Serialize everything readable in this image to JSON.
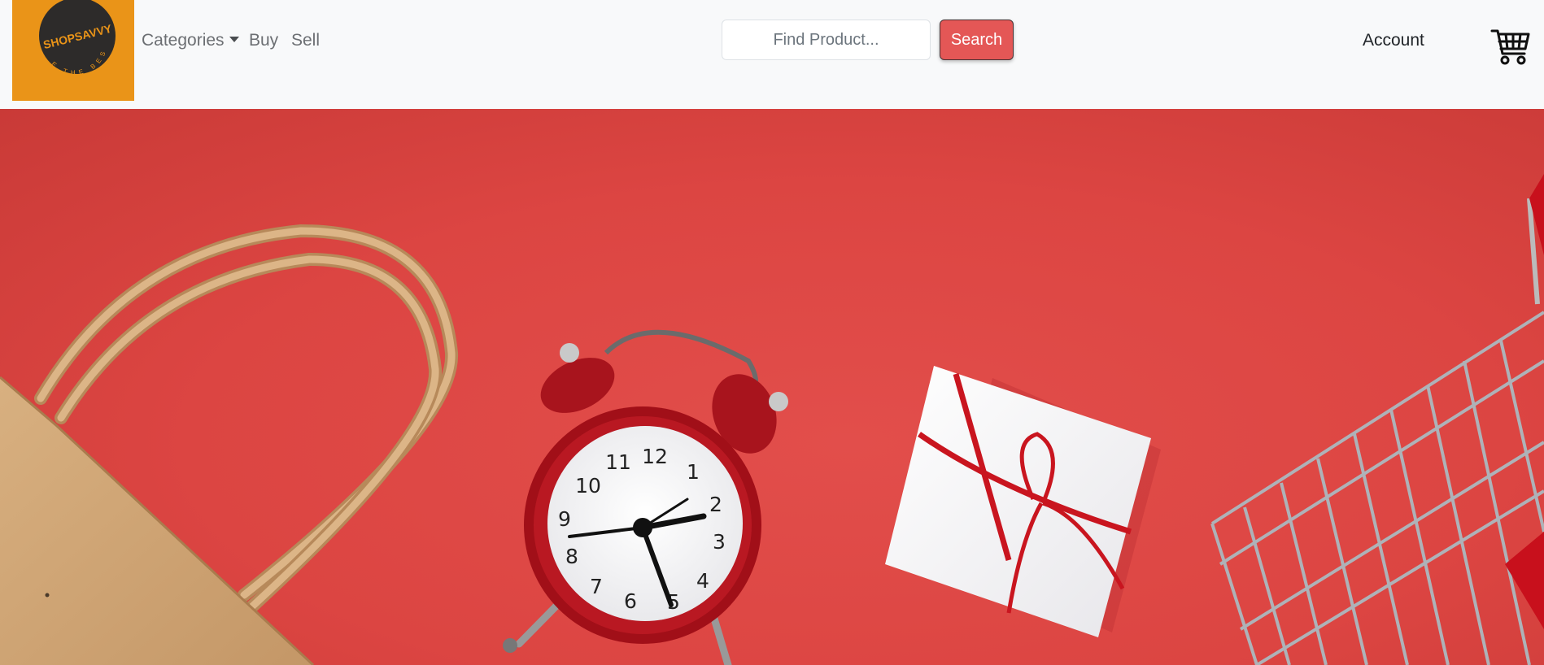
{
  "brand": {
    "name": "SHOPSAVVY",
    "tagline": "WE THE BEST",
    "logo_bg": "#ea9418",
    "logo_circle": "#2d2b2a"
  },
  "nav": {
    "categories_label": "Categories",
    "buy_label": "Buy",
    "sell_label": "Sell",
    "account_label": "Account"
  },
  "search": {
    "placeholder": "Find Product...",
    "value": "",
    "button_label": "Search",
    "button_color": "#e45756"
  },
  "icons": {
    "cart": "shopping-cart-icon",
    "caret": "caret-down-icon"
  },
  "hero": {
    "background": "#dc4542",
    "clock_numbers": [
      "12",
      "1",
      "2",
      "3",
      "4",
      "5",
      "6",
      "7",
      "8",
      "9",
      "10",
      "11"
    ]
  }
}
